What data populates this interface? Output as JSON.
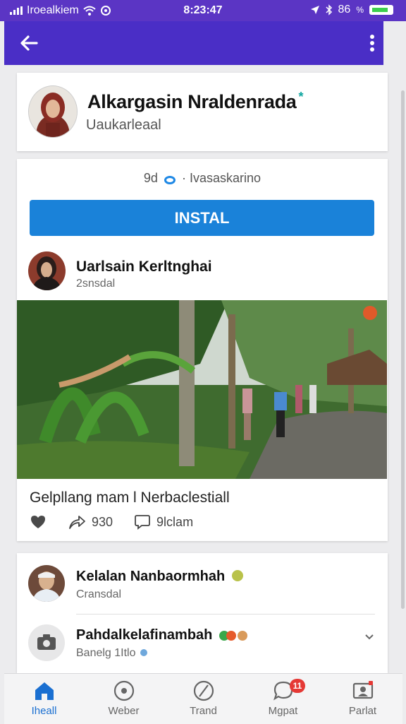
{
  "status_bar": {
    "carrier": "Iroealkiem",
    "time": "8:23:47",
    "battery": "86"
  },
  "profile": {
    "name": "Alkargasin Nraldenrada",
    "subtitle": "Uaukarleaal"
  },
  "post": {
    "stats_count": "9d",
    "stats_text": "Ivasaskarino",
    "install_label": "INSTAL",
    "author": "Uarlsain Kerltnghai",
    "time": "2snsdal",
    "caption": "Gelpllang mam l Nerbaclestiall",
    "shares": "930",
    "comments": "9lclam"
  },
  "comments": [
    {
      "name": "Kelalan Nanbaormhah",
      "sub": "Cransdal"
    },
    {
      "name": "Pahdalkelafinambah",
      "sub": "Banelg 1Itlo"
    }
  ],
  "nav": [
    {
      "label": "Iheall"
    },
    {
      "label": "Weber"
    },
    {
      "label": "Trand"
    },
    {
      "label": "Mgpat",
      "badge": "11"
    },
    {
      "label": "Parlat"
    }
  ],
  "colors": {
    "status_bar": "#5b35c4",
    "app_bar": "#4a2ec6",
    "install": "#1a82d9",
    "nav_active": "#1a6fd1"
  }
}
